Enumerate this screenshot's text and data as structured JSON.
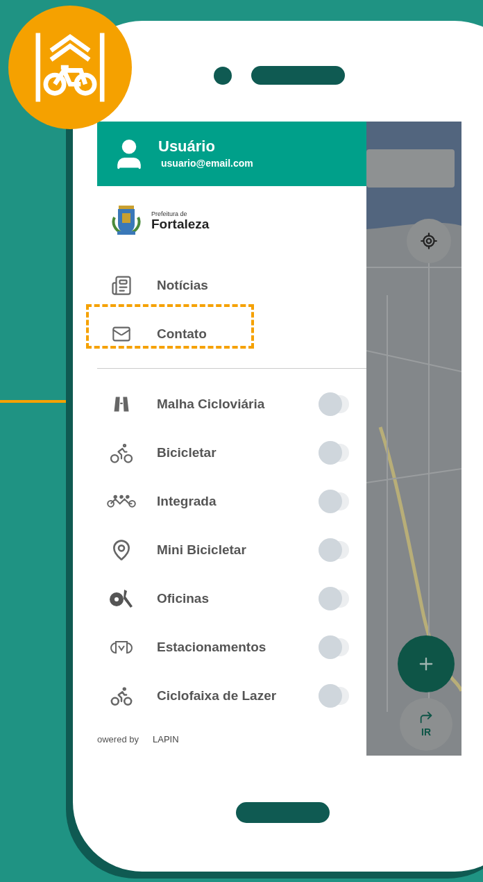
{
  "user": {
    "name": "Usuário",
    "email": "usuario@email.com"
  },
  "brand": {
    "line_1": "Prefeitura de",
    "line_2": "Fortaleza"
  },
  "menu": [
    {
      "label": "Notícias",
      "highlighted": false
    },
    {
      "label": "Contato",
      "highlighted": true
    }
  ],
  "layers": [
    {
      "label": "Malha Cicloviária",
      "on": false
    },
    {
      "label": "Bicicletar",
      "on": false
    },
    {
      "label": "Integrada",
      "on": false
    },
    {
      "label": "Mini Bicicletar",
      "on": false
    },
    {
      "label": "Oficinas",
      "on": false
    },
    {
      "label": "Estacionamentos",
      "on": false
    },
    {
      "label": "Ciclofaixa de Lazer",
      "on": false
    }
  ],
  "footer": {
    "powered_by": "owered by",
    "brand": "LAPIN"
  },
  "map": {
    "go_button": "IR"
  }
}
